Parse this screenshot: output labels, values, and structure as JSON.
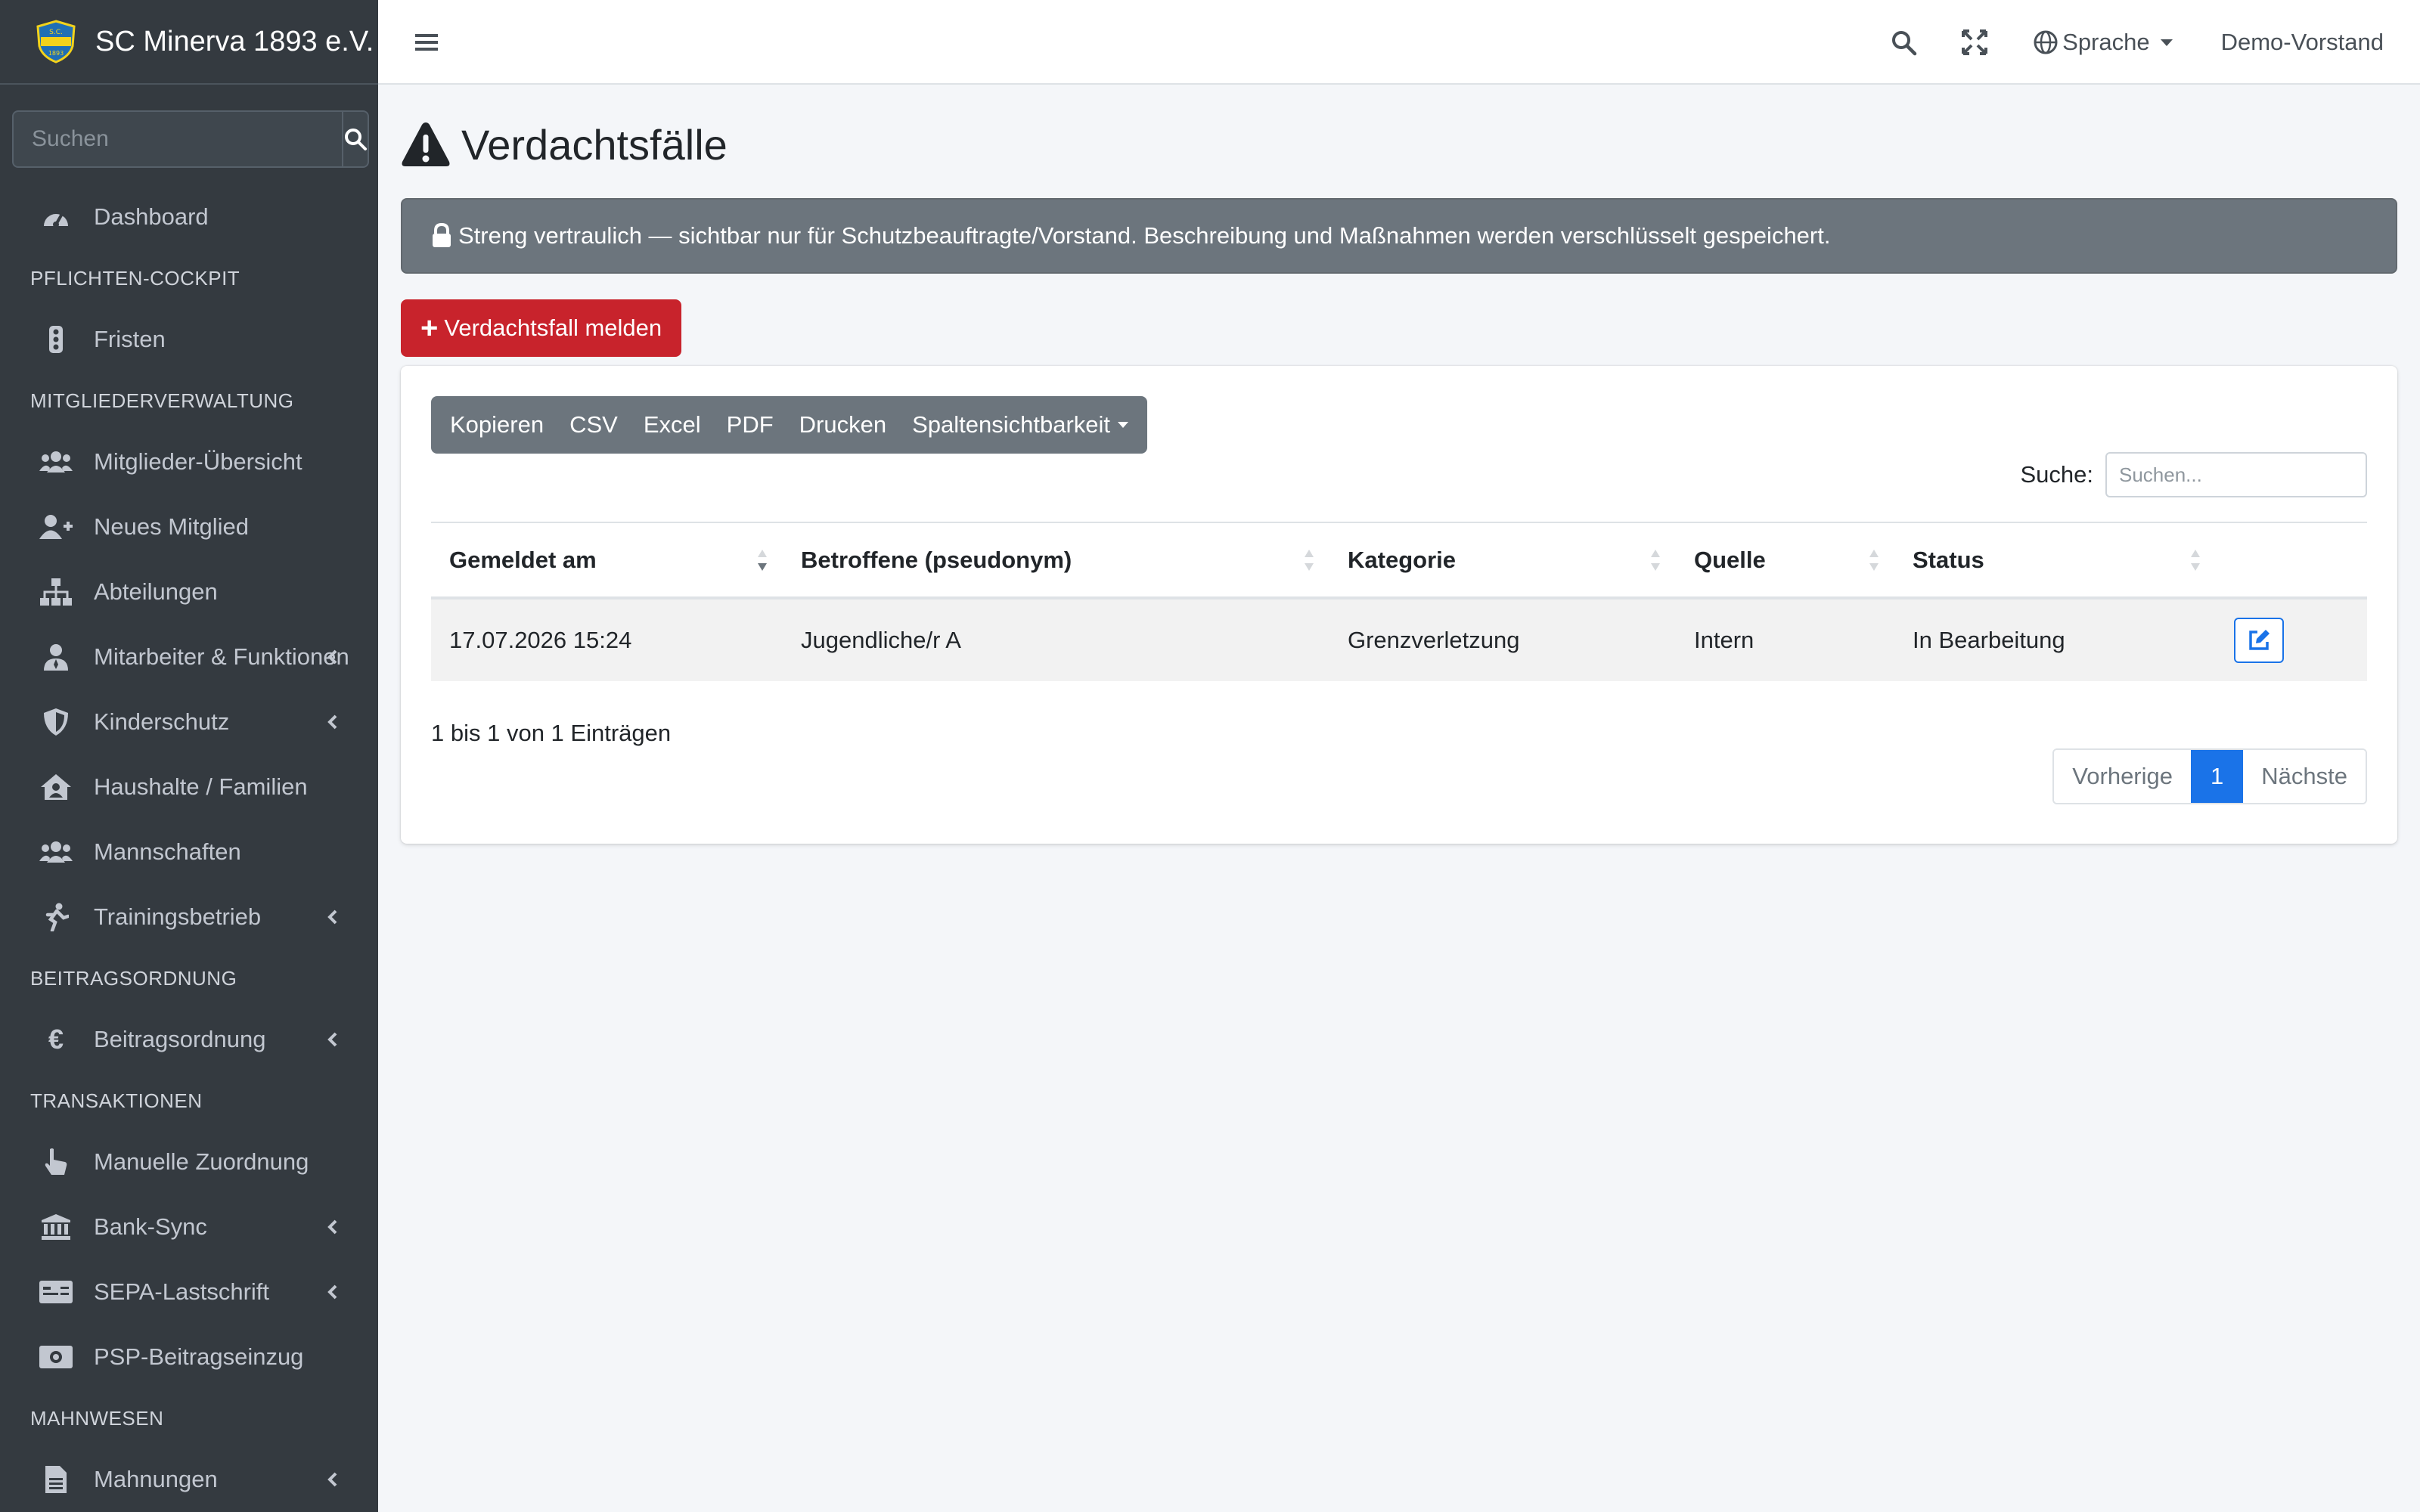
{
  "brand": {
    "name": "SC Minerva 1893 e.V."
  },
  "sidebar": {
    "search_placeholder": "Suchen",
    "dashboard": "Dashboard",
    "sections": {
      "pflichten": "PFLICHTEN-COCKPIT",
      "mitglieder": "MITGLIEDERVERWALTUNG",
      "beitrag": "BEITRAGSORDNUNG",
      "transaktionen": "TRANSAKTIONEN",
      "mahnwesen": "MAHNWESEN"
    },
    "items": {
      "fristen": "Fristen",
      "mitglieder_uebersicht": "Mitglieder-Übersicht",
      "neues_mitglied": "Neues Mitglied",
      "abteilungen": "Abteilungen",
      "mitarbeiter": "Mitarbeiter & Funktionen",
      "kinderschutz": "Kinderschutz",
      "haushalte": "Haushalte / Familien",
      "mannschaften": "Mannschaften",
      "trainingsbetrieb": "Trainingsbetrieb",
      "beitragsordnung": "Beitragsordnung",
      "manuelle_zuordnung": "Manuelle Zuordnung",
      "bank_sync": "Bank-Sync",
      "sepa": "SEPA-Lastschrift",
      "psp": "PSP-Beitragseinzug",
      "mahnungen": "Mahnungen"
    }
  },
  "topbar": {
    "language": "Sprache",
    "user": "Demo-Vorstand"
  },
  "page": {
    "title": "Verdachtsfälle",
    "alert": "Streng vertraulich — sichtbar nur für Schutzbeauftragte/Vorstand. Beschreibung und Maßnahmen werden verschlüsselt gespeichert.",
    "report_button": "Verdachtsfall melden"
  },
  "table": {
    "buttons": [
      "Kopieren",
      "CSV",
      "Excel",
      "PDF",
      "Drucken",
      "Spaltensichtbarkeit"
    ],
    "search_label": "Suche:",
    "search_placeholder": "Suchen...",
    "columns": [
      "Gemeldet am",
      "Betroffene (pseudonym)",
      "Kategorie",
      "Quelle",
      "Status"
    ],
    "rows": [
      {
        "date": "17.07.2026 15:24",
        "affected": "Jugendliche/r A",
        "category": "Grenzverletzung",
        "source": "Intern",
        "status": "In Bearbeitung"
      }
    ],
    "info": "1 bis 1 von 1 Einträgen",
    "pagination": {
      "prev": "Vorherige",
      "current": "1",
      "next": "Nächste"
    }
  },
  "colors": {
    "sidebar_bg": "#343a40",
    "danger": "#c8232c",
    "primary": "#1a73e8",
    "alert_bg": "#6c757d"
  }
}
